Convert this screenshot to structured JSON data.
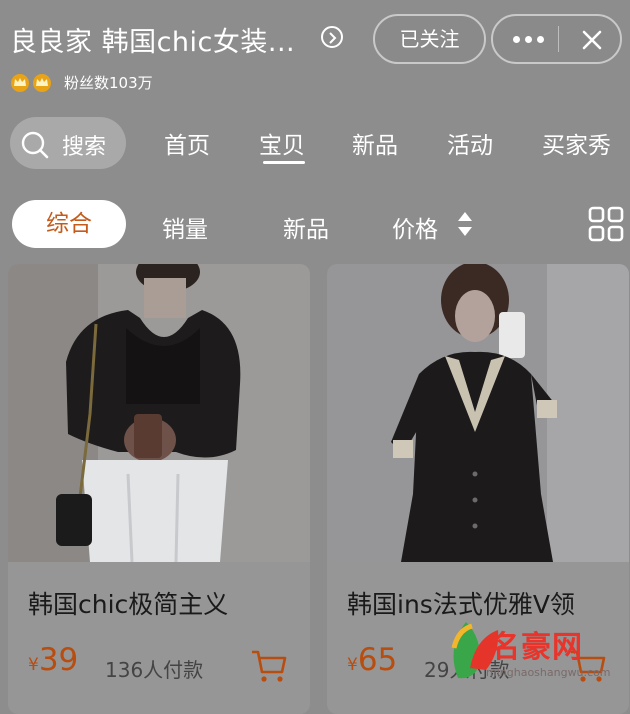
{
  "header": {
    "shop_name": "良良家 韩国chic女装...",
    "fans_label": "粉丝数103万",
    "follow_button": "已关注"
  },
  "nav": {
    "search_label": "搜索",
    "tabs": [
      "首页",
      "宝贝",
      "新品",
      "活动",
      "买家秀"
    ],
    "active_tab": "宝贝"
  },
  "sort": {
    "items": [
      "综合",
      "销量",
      "新品",
      "价格"
    ],
    "active": "综合"
  },
  "products": [
    {
      "title": "韩国chic极简主义",
      "currency": "¥",
      "price": "39",
      "sold": "136人付款"
    },
    {
      "title": "韩国ins法式优雅V领",
      "currency": "¥",
      "price": "65",
      "sold": "29人付款"
    }
  ],
  "watermark": {
    "text": "名豪网",
    "sub": "minghaoshangwu.com"
  },
  "colors": {
    "accent": "#c45a1b",
    "price": "#b84d10",
    "overlay": "#8d8d8d"
  },
  "icons": [
    "chevron-right-circle-icon",
    "crown-icon",
    "more-icon",
    "close-icon",
    "search-icon",
    "sort-arrows-icon",
    "grid-view-icon",
    "cart-icon"
  ]
}
